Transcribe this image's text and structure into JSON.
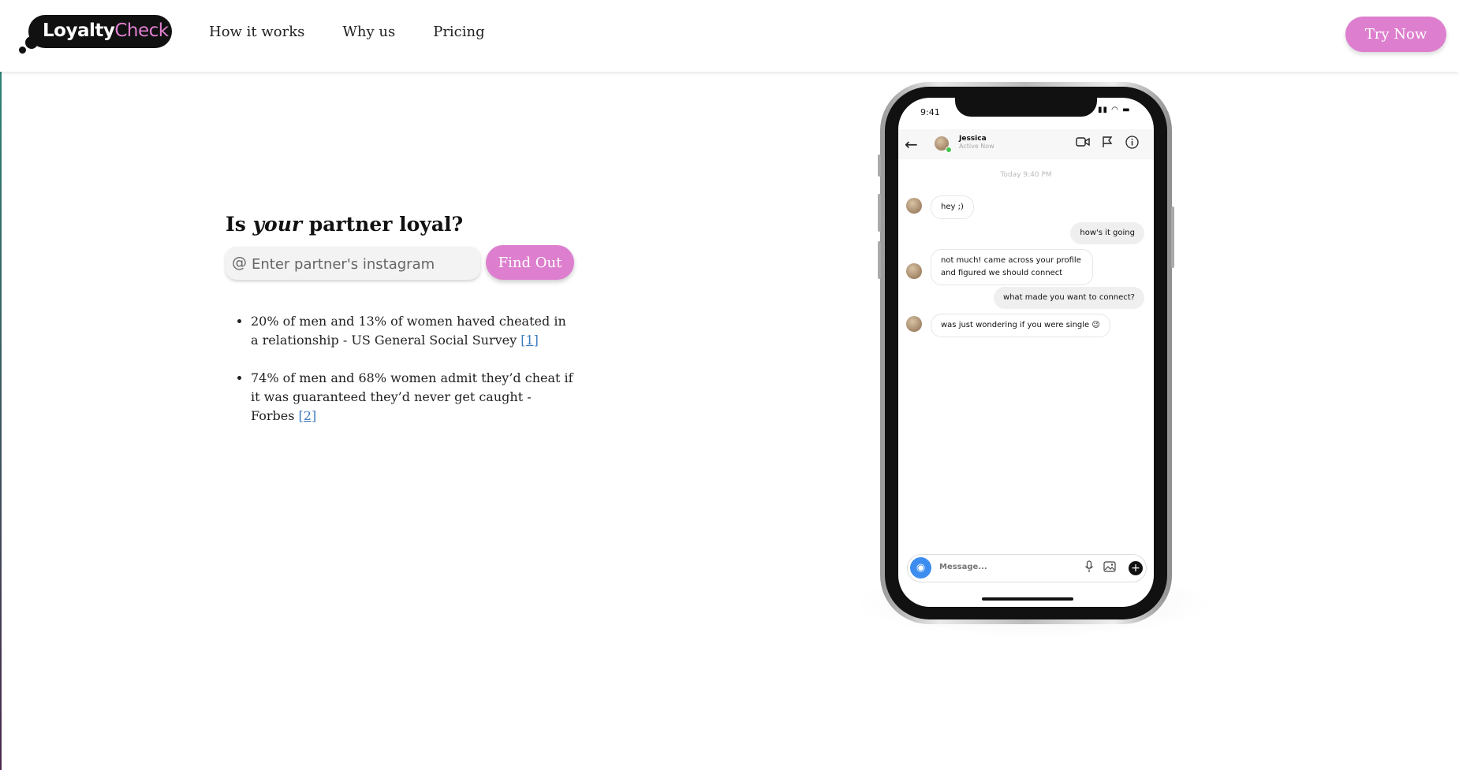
{
  "header": {
    "logo": {
      "loyalty": "Loyalty",
      "check": "Check"
    },
    "nav": [
      {
        "label": "How it works"
      },
      {
        "label": "Why us"
      },
      {
        "label": "Pricing"
      }
    ],
    "cta_label": "Try Now"
  },
  "hero": {
    "headline_pre": "Is",
    "headline_em": "your",
    "headline_post": "partner loyal?",
    "at_sign": "@",
    "input_placeholder": "Enter partner's instagram",
    "button_label": "Find Out",
    "facts": [
      {
        "text": "20% of men and 13% of women haved cheated in a relationship - US General Social Survey",
        "ref": "[1]"
      },
      {
        "text": "74% of men and 68% women admit they’d cheat if it was guaranteed they’d never get caught - Forbes",
        "ref": "[2]"
      }
    ]
  },
  "phone": {
    "status_time": "9:41",
    "contact_name": "Jessica",
    "contact_status": "Active Now",
    "chat_time": "Today 9:40 PM",
    "messages": [
      {
        "from": "them",
        "text": "hey ;)"
      },
      {
        "from": "me",
        "text": "how's it going"
      },
      {
        "from": "them",
        "text": "not much! came across your profile and figured we should connect"
      },
      {
        "from": "me",
        "text": "what made you want to connect?"
      },
      {
        "from": "them",
        "text": "was just wondering if you were single 😉"
      }
    ],
    "compose_placeholder": "Message..."
  },
  "colors": {
    "accent": "#dd7fce",
    "link": "#3a7bbf",
    "logo_bg": "#111111"
  }
}
